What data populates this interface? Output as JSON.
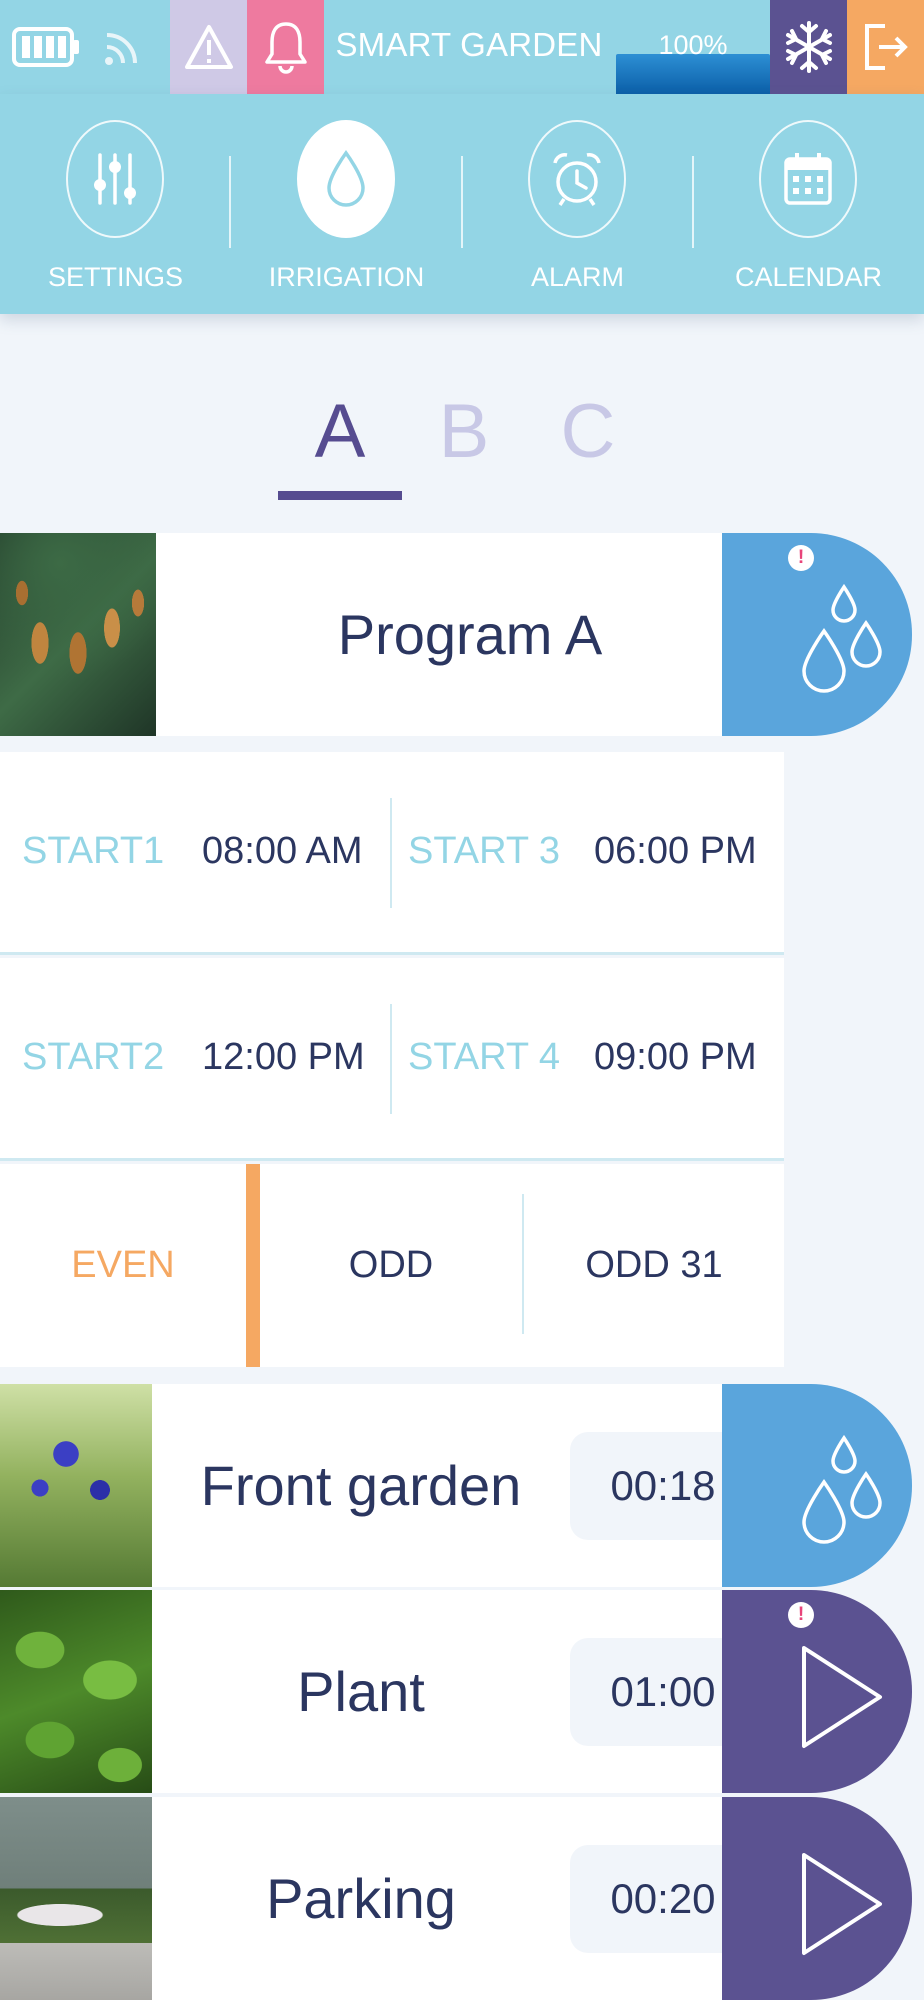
{
  "app": {
    "title": "SMART GARDEN",
    "level_text": "100%",
    "level_fraction": 1.0,
    "colors": {
      "primary": "#93d5e5",
      "purple": "#564c90",
      "blue": "#5aa5dc",
      "orange": "#f5a862",
      "pink": "#ee7a9f",
      "lavender": "#cfc9e6"
    }
  },
  "status_icons": [
    "battery-icon",
    "wifi-icon",
    "warning-icon",
    "bell-icon",
    "snowflake-icon",
    "logout-icon"
  ],
  "nav": {
    "items": [
      {
        "label": "SETTINGS",
        "icon": "sliders-icon",
        "active": false
      },
      {
        "label": "IRRIGATION",
        "icon": "water-drop-icon",
        "active": true
      },
      {
        "label": "ALARM",
        "icon": "alarm-clock-icon",
        "active": false
      },
      {
        "label": "CALENDAR",
        "icon": "calendar-icon",
        "active": false
      }
    ]
  },
  "tabs": [
    {
      "label": "A",
      "active": true
    },
    {
      "label": "B",
      "active": false
    },
    {
      "label": "C",
      "active": false
    }
  ],
  "program": {
    "title": "Program A",
    "action_icon": "water-drops-icon",
    "alert_mark": "!"
  },
  "schedule": {
    "row1": {
      "left": {
        "label": "START1",
        "time": "08:00 AM"
      },
      "right": {
        "label": "START 3",
        "time": "06:00 PM"
      }
    },
    "row2": {
      "left": {
        "label": "START2",
        "time": "12:00 PM"
      },
      "right": {
        "label": "START 4",
        "time": "09:00 PM"
      }
    }
  },
  "days": {
    "options": [
      "EVEN",
      "ODD",
      "ODD 31"
    ],
    "selected": "EVEN"
  },
  "zones": [
    {
      "name": "Front garden",
      "duration": "00:18",
      "action_icon": "water-drops-icon",
      "alert": false
    },
    {
      "name": "Plant",
      "duration": "01:00",
      "action_icon": "play-icon",
      "alert": true,
      "alert_mark": "!"
    },
    {
      "name": "Parking",
      "duration": "00:20",
      "action_icon": "play-icon",
      "alert": false
    }
  ]
}
